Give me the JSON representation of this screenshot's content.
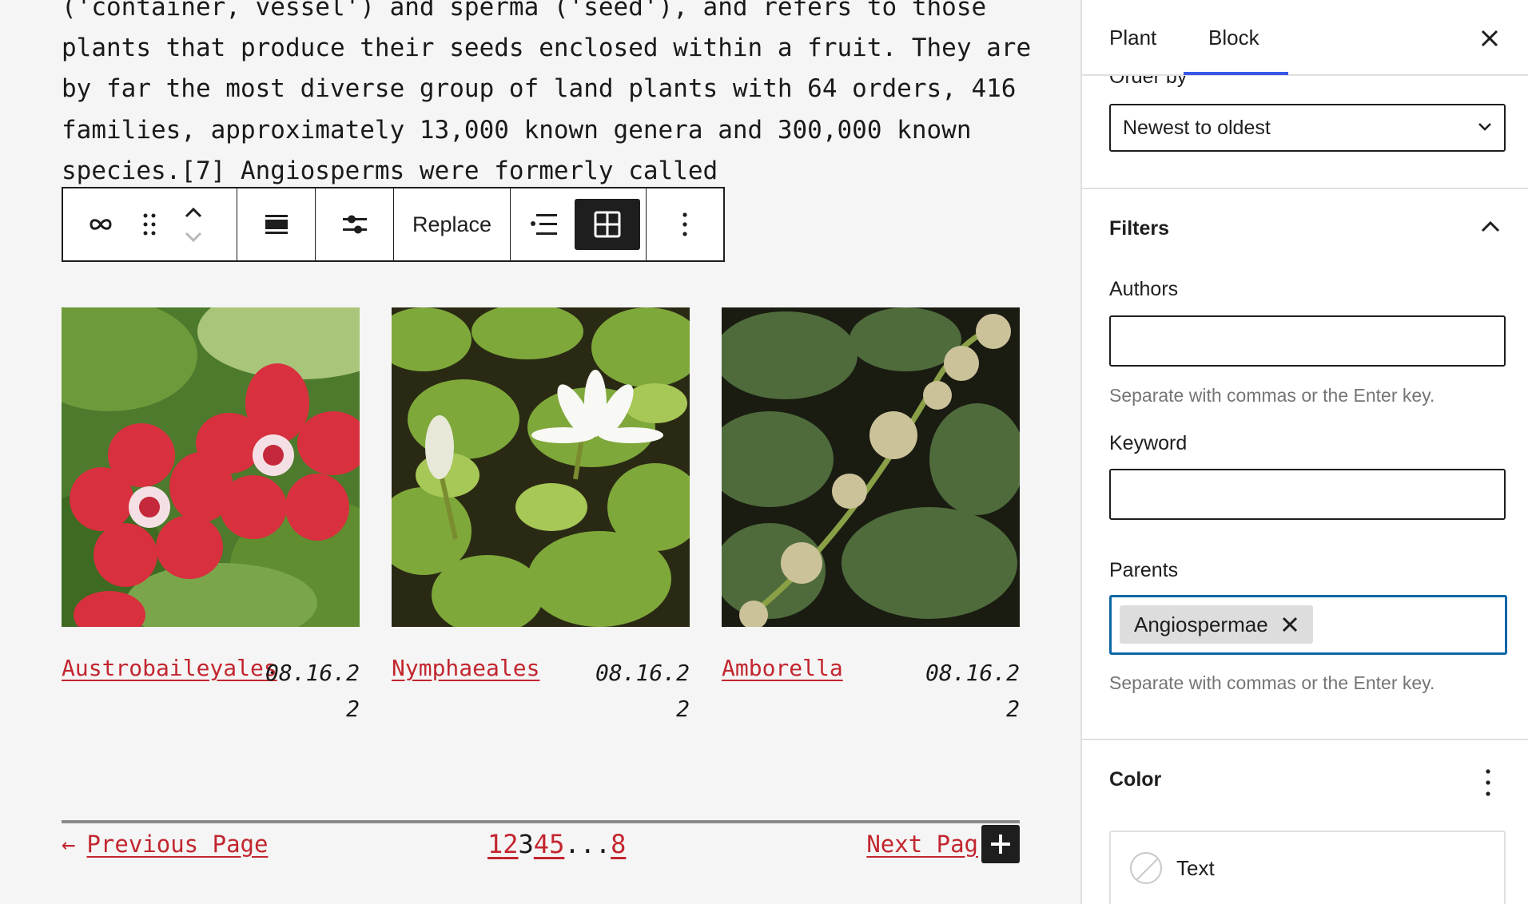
{
  "paragraph_text": "('container, vessel') and sperma ('seed'), and refers to those plants that produce their seeds enclosed within a fruit. They are by far the most diverse group of land plants with 64 orders, 416 families, approximately 13,000 known genera and 300,000 known species.[7] Angiosperms were formerly called",
  "toolbar": {
    "parent_icon": "link-icon",
    "drag_icon": "drag-handle-icon",
    "move_up_icon": "chevron-up-icon",
    "move_down_icon": "chevron-down-icon",
    "align_icon": "align-wide-icon",
    "settings_icon": "sliders-icon",
    "replace_label": "Replace",
    "list_view_icon": "list-view-icon",
    "grid_view_icon": "grid-view-icon",
    "more_icon": "more-vertical-icon"
  },
  "posts": [
    {
      "title": "Austrobaileyales",
      "date": "08.16.22",
      "image": "red-flowers-photo"
    },
    {
      "title": "Nymphaeales",
      "date": "08.16.22",
      "image": "water-lily-photo"
    },
    {
      "title": "Amborella",
      "date": "08.16.22",
      "image": "amborella-plant-photo"
    }
  ],
  "pagination": {
    "prev_arrow": "←",
    "prev_label": "Previous Page",
    "pages": [
      "1",
      "2",
      "3",
      "4",
      "5"
    ],
    "current_page": "3",
    "dots": "...",
    "last_page": "8",
    "next_label": "Next Pag"
  },
  "sidebar": {
    "tabs": [
      "Plant",
      "Block"
    ],
    "active_tab": "Block",
    "order_label": "Order by",
    "order_value": "Newest to oldest",
    "filters_title": "Filters",
    "authors_label": "Authors",
    "authors_value": "",
    "authors_help": "Separate with commas or the Enter key.",
    "keyword_label": "Keyword",
    "keyword_value": "",
    "parents_label": "Parents",
    "parents_token": "Angiospermae",
    "parents_help": "Separate with commas or the Enter key.",
    "color_title": "Color",
    "text_color_label": "Text"
  },
  "colors": {
    "link": "#c2262f",
    "accent": "#3858e9",
    "focus": "#0a66a6",
    "text": "#1e1e1e"
  }
}
